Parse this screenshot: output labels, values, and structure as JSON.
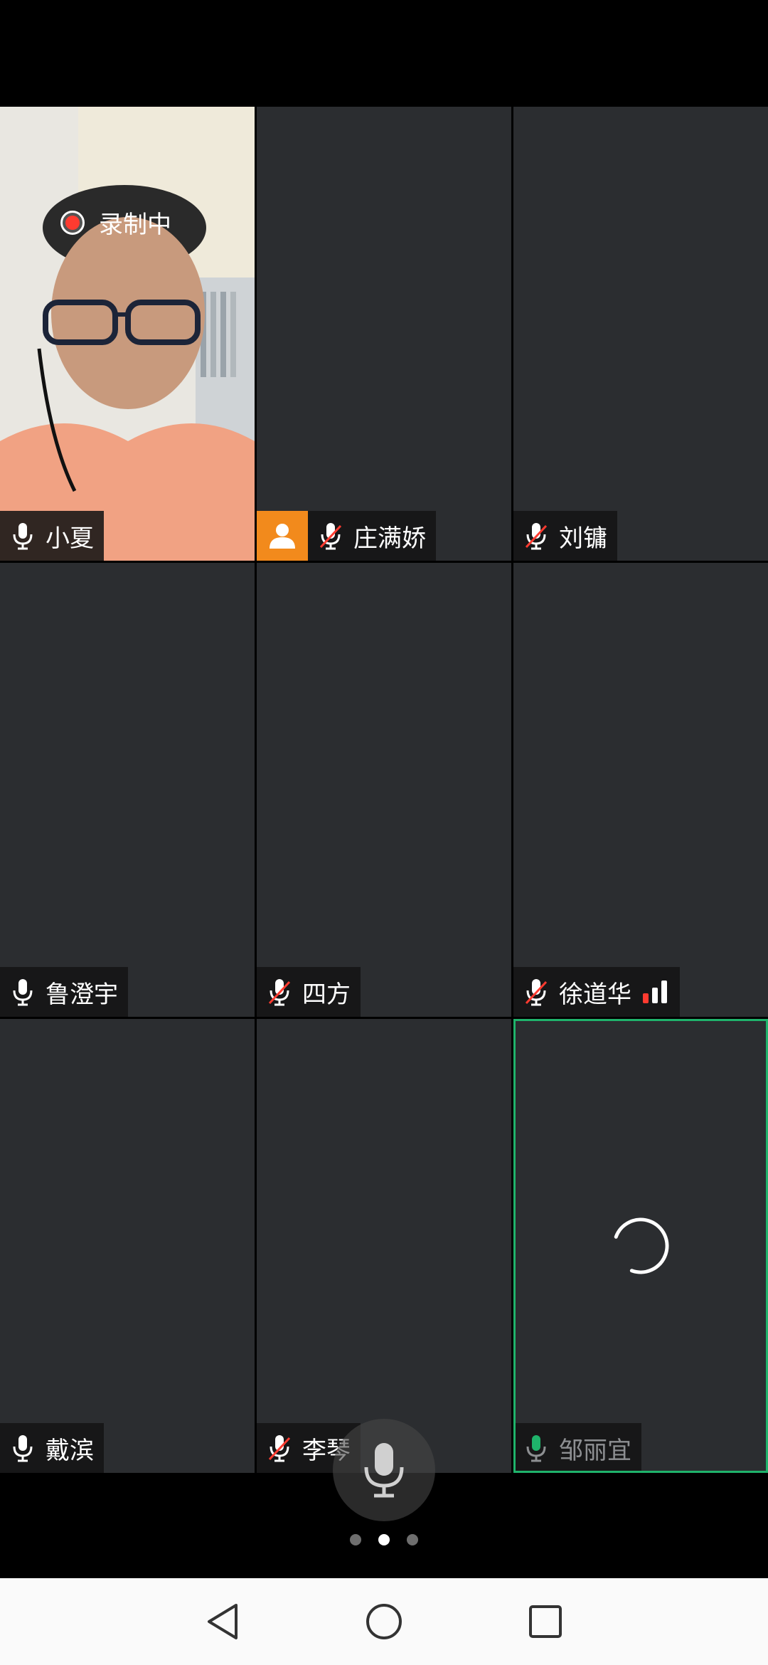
{
  "recording": {
    "label": "录制中"
  },
  "participants": [
    {
      "name": "小夏",
      "mic": "on"
    },
    {
      "name": "庄满娇",
      "mic": "muted",
      "host": true
    },
    {
      "name": "刘镛",
      "mic": "muted"
    },
    {
      "name": "鲁澄宇",
      "mic": "on"
    },
    {
      "name": "四方",
      "mic": "muted"
    },
    {
      "name": "徐道华",
      "mic": "muted",
      "signal": "weak"
    },
    {
      "name": "戴滨",
      "mic": "on"
    },
    {
      "name": "李琴",
      "mic": "muted"
    },
    {
      "name": "邹丽宜",
      "mic": "on",
      "loading": true
    }
  ],
  "pager": {
    "pages": 3,
    "current": 2
  },
  "colors": {
    "accent": "#1fb36b",
    "host": "#f28a1c",
    "muted_slash": "#ff3b30",
    "tile": "#2b2d30"
  },
  "icons": [
    "mic-icon",
    "mic-muted-icon",
    "person-icon",
    "signal-icon",
    "spinner-icon",
    "back-icon",
    "home-icon",
    "recents-icon"
  ]
}
